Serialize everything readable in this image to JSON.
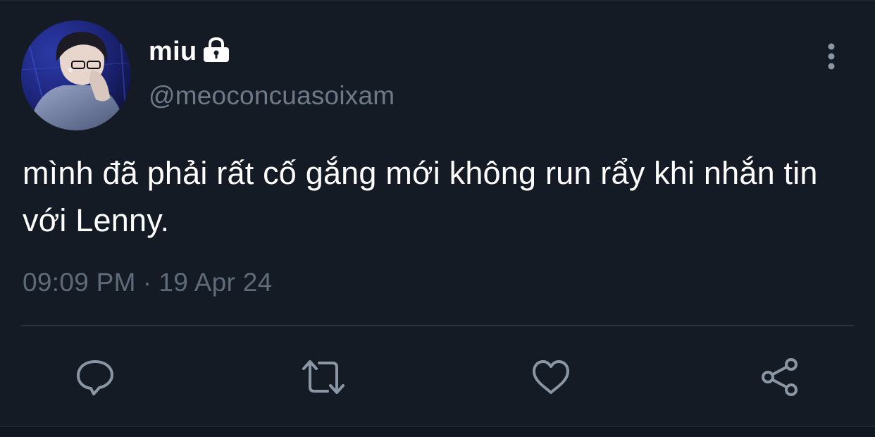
{
  "user": {
    "display_name": "miu",
    "handle": "@meoconcuasoixam",
    "protected_icon": "lock-icon"
  },
  "tweet": {
    "text": "mình đã phải rất cố gắng mới không run rẩy khi nhắn tin với Lenny.",
    "time": "09:09 PM",
    "separator": "·",
    "date": "19 Apr 24"
  },
  "actions": [
    {
      "name": "reply",
      "icon": "speech-bubble-icon"
    },
    {
      "name": "retweet",
      "icon": "retweet-arrows-icon"
    },
    {
      "name": "like",
      "icon": "heart-icon"
    },
    {
      "name": "share",
      "icon": "share-nodes-icon"
    }
  ],
  "colors": {
    "background": "#151b24",
    "primary_text": "#ffffff",
    "secondary_text": "#6e7a88",
    "icon": "#8a96a3",
    "divider": "#2b323c"
  }
}
